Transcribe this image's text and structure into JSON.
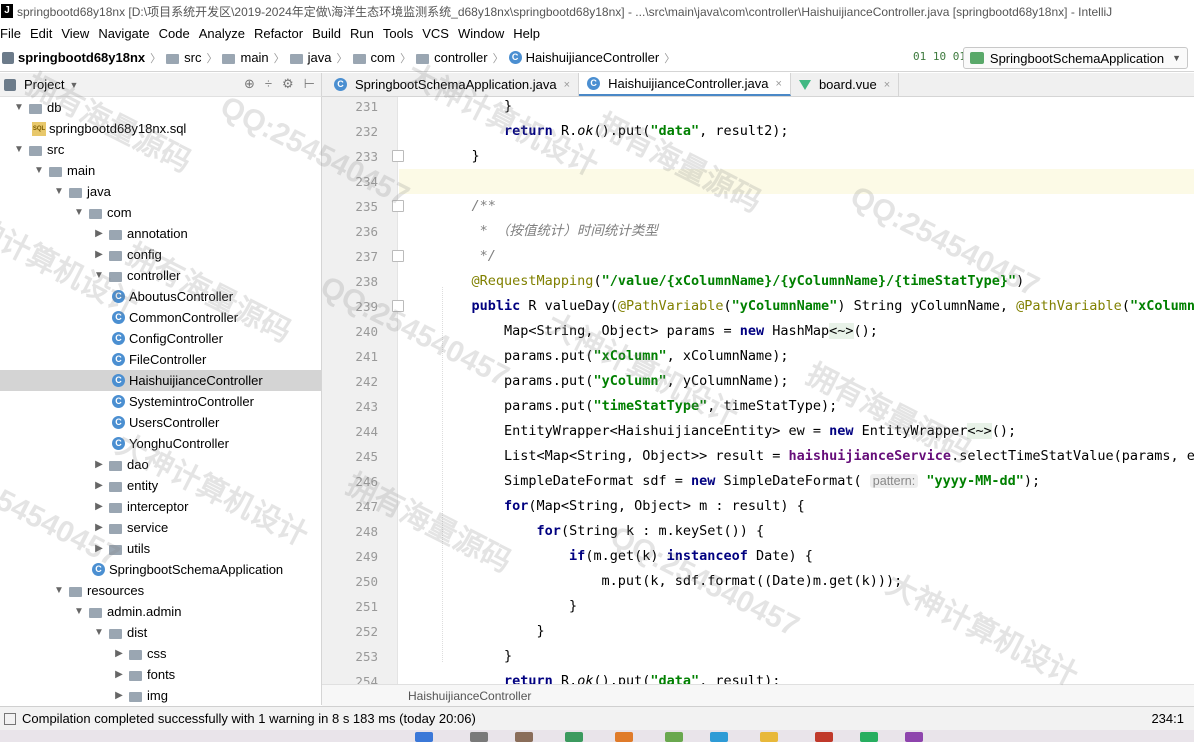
{
  "titlebar": {
    "text": "springbootd68y18nx [D:\\项目系统开发区\\2019-2024年定做\\海洋生态环境监测系统_d68y18nx\\springbootd68y18nx] - ...\\src\\main\\java\\com\\controller\\HaishuijianceController.java [springbootd68y18nx] - IntelliJ"
  },
  "menu": [
    "File",
    "Edit",
    "View",
    "Navigate",
    "Code",
    "Analyze",
    "Refactor",
    "Build",
    "Run",
    "Tools",
    "VCS",
    "Window",
    "Help"
  ],
  "breadcrumb": [
    "springbootd68y18nx",
    "src",
    "main",
    "java",
    "com",
    "controller",
    "HaishuijianceController"
  ],
  "run_config": "SpringbootSchemaApplication",
  "sort_label": "01 10 01",
  "project_panel": {
    "title": "Project",
    "dropdown_glyph": "▼",
    "tools": [
      "⊕",
      "÷",
      "⚙",
      "⊢"
    ]
  },
  "tree": [
    {
      "label": "db",
      "indent": 1,
      "arrow": "open",
      "icon": "folder"
    },
    {
      "label": "springbootd68y18nx.sql",
      "indent": 2,
      "arrow": "none",
      "icon": "sql"
    },
    {
      "label": "src",
      "indent": 1,
      "arrow": "open",
      "icon": "folder"
    },
    {
      "label": "main",
      "indent": 2,
      "arrow": "open",
      "icon": "folder"
    },
    {
      "label": "java",
      "indent": 3,
      "arrow": "open",
      "icon": "folder"
    },
    {
      "label": "com",
      "indent": 4,
      "arrow": "open",
      "icon": "folder"
    },
    {
      "label": "annotation",
      "indent": 5,
      "arrow": "closed",
      "icon": "folder"
    },
    {
      "label": "config",
      "indent": 5,
      "arrow": "closed",
      "icon": "folder"
    },
    {
      "label": "controller",
      "indent": 5,
      "arrow": "open",
      "icon": "folder"
    },
    {
      "label": "AboutusController",
      "indent": 6,
      "arrow": "none",
      "icon": "class"
    },
    {
      "label": "CommonController",
      "indent": 6,
      "arrow": "none",
      "icon": "class"
    },
    {
      "label": "ConfigController",
      "indent": 6,
      "arrow": "none",
      "icon": "class"
    },
    {
      "label": "FileController",
      "indent": 6,
      "arrow": "none",
      "icon": "class"
    },
    {
      "label": "HaishuijianceController",
      "indent": 6,
      "arrow": "none",
      "icon": "class",
      "selected": true
    },
    {
      "label": "SystemintroController",
      "indent": 6,
      "arrow": "none",
      "icon": "class"
    },
    {
      "label": "UsersController",
      "indent": 6,
      "arrow": "none",
      "icon": "class"
    },
    {
      "label": "YonghuController",
      "indent": 6,
      "arrow": "none",
      "icon": "class"
    },
    {
      "label": "dao",
      "indent": 5,
      "arrow": "closed",
      "icon": "folder"
    },
    {
      "label": "entity",
      "indent": 5,
      "arrow": "closed",
      "icon": "folder"
    },
    {
      "label": "interceptor",
      "indent": 5,
      "arrow": "closed",
      "icon": "folder"
    },
    {
      "label": "service",
      "indent": 5,
      "arrow": "closed",
      "icon": "folder"
    },
    {
      "label": "utils",
      "indent": 5,
      "arrow": "closed",
      "icon": "folder"
    },
    {
      "label": "SpringbootSchemaApplication",
      "indent": 5,
      "arrow": "none",
      "icon": "class"
    },
    {
      "label": "resources",
      "indent": 3,
      "arrow": "open",
      "icon": "folder"
    },
    {
      "label": "admin.admin",
      "indent": 4,
      "arrow": "open",
      "icon": "folder"
    },
    {
      "label": "dist",
      "indent": 5,
      "arrow": "open",
      "icon": "folder"
    },
    {
      "label": "css",
      "indent": 6,
      "arrow": "closed",
      "icon": "folder"
    },
    {
      "label": "fonts",
      "indent": 6,
      "arrow": "closed",
      "icon": "folder"
    },
    {
      "label": "img",
      "indent": 6,
      "arrow": "closed",
      "icon": "folder"
    }
  ],
  "tabs": [
    {
      "label": "SpringbootSchemaApplication.java",
      "icon": "class",
      "active": false
    },
    {
      "label": "HaishuijianceController.java",
      "icon": "class",
      "active": true
    },
    {
      "label": "board.vue",
      "icon": "vue",
      "active": false
    }
  ],
  "close_glyph": "×",
  "editor": {
    "line_numbers": [
      231,
      232,
      233,
      234,
      235,
      236,
      237,
      238,
      239,
      240,
      241,
      242,
      243,
      244,
      245,
      246,
      247,
      248,
      249,
      250,
      251,
      252,
      253,
      254
    ],
    "current_line": 234,
    "fold_markers": [
      233,
      235,
      237,
      239
    ],
    "lines": [
      [
        {
          "t": "        }",
          "c": ""
        }
      ],
      [
        {
          "t": "        ",
          "c": ""
        },
        {
          "t": "return",
          "c": "kw"
        },
        {
          "t": " R.",
          "c": ""
        },
        {
          "t": "ok",
          "c": "it"
        },
        {
          "t": "().put(",
          "c": ""
        },
        {
          "t": "\"data\"",
          "c": "str"
        },
        {
          "t": ", result2);",
          "c": ""
        }
      ],
      [
        {
          "t": "    }",
          "c": ""
        }
      ],
      [
        {
          "t": "",
          "c": ""
        }
      ],
      [
        {
          "t": "    /**",
          "c": "com"
        }
      ],
      [
        {
          "t": "     * （按值统计）时间统计类型",
          "c": "com"
        }
      ],
      [
        {
          "t": "     */",
          "c": "com"
        }
      ],
      [
        {
          "t": "    ",
          "c": ""
        },
        {
          "t": "@RequestMapping",
          "c": "ann"
        },
        {
          "t": "(",
          "c": ""
        },
        {
          "t": "\"/value/{xColumnName}/{yColumnName}/{timeStatType}\"",
          "c": "str"
        },
        {
          "t": ")",
          "c": ""
        }
      ],
      [
        {
          "t": "    ",
          "c": ""
        },
        {
          "t": "public",
          "c": "kw"
        },
        {
          "t": " R valueDay(",
          "c": ""
        },
        {
          "t": "@PathVariable",
          "c": "ann"
        },
        {
          "t": "(",
          "c": ""
        },
        {
          "t": "\"yColumnName\"",
          "c": "str"
        },
        {
          "t": ") String yColumnName, ",
          "c": ""
        },
        {
          "t": "@PathVariable",
          "c": "ann"
        },
        {
          "t": "(",
          "c": ""
        },
        {
          "t": "\"xColumnName\"",
          "c": "str"
        }
      ],
      [
        {
          "t": "        Map<String, Object> params = ",
          "c": ""
        },
        {
          "t": "new",
          "c": "kw"
        },
        {
          "t": " HashMap",
          "c": ""
        },
        {
          "t": "<~>",
          "c": "dia"
        },
        {
          "t": "();",
          "c": ""
        }
      ],
      [
        {
          "t": "        params.put(",
          "c": ""
        },
        {
          "t": "\"xColumn\"",
          "c": "str"
        },
        {
          "t": ", xColumnName);",
          "c": ""
        }
      ],
      [
        {
          "t": "        params.put(",
          "c": ""
        },
        {
          "t": "\"yColumn\"",
          "c": "str"
        },
        {
          "t": ", yColumnName);",
          "c": ""
        }
      ],
      [
        {
          "t": "        params.put(",
          "c": ""
        },
        {
          "t": "\"timeStatType\"",
          "c": "str"
        },
        {
          "t": ", timeStatType);",
          "c": ""
        }
      ],
      [
        {
          "t": "        EntityWrapper<HaishuijianceEntity> ew = ",
          "c": ""
        },
        {
          "t": "new",
          "c": "kw"
        },
        {
          "t": " EntityWrapper",
          "c": ""
        },
        {
          "t": "<~>",
          "c": "dia"
        },
        {
          "t": "();",
          "c": ""
        }
      ],
      [
        {
          "t": "        List<Map<String, Object>> result = ",
          "c": ""
        },
        {
          "t": "haishuijianceService",
          "c": "fld"
        },
        {
          "t": ".selectTimeStatValue(params, ew);",
          "c": ""
        }
      ],
      [
        {
          "t": "        SimpleDateFormat sdf = ",
          "c": ""
        },
        {
          "t": "new",
          "c": "kw"
        },
        {
          "t": " SimpleDateFormat( ",
          "c": ""
        },
        {
          "t": "pattern:",
          "c": "hint"
        },
        {
          "t": " ",
          "c": ""
        },
        {
          "t": "\"yyyy-MM-dd\"",
          "c": "str"
        },
        {
          "t": ");",
          "c": ""
        }
      ],
      [
        {
          "t": "        ",
          "c": ""
        },
        {
          "t": "for",
          "c": "kw"
        },
        {
          "t": "(Map<String, Object> m : result) {",
          "c": ""
        }
      ],
      [
        {
          "t": "            ",
          "c": ""
        },
        {
          "t": "for",
          "c": "kw"
        },
        {
          "t": "(String k : m.keySet()) {",
          "c": ""
        }
      ],
      [
        {
          "t": "                ",
          "c": ""
        },
        {
          "t": "if",
          "c": "kw"
        },
        {
          "t": "(m.get(k) ",
          "c": ""
        },
        {
          "t": "instanceof",
          "c": "kw"
        },
        {
          "t": " Date) {",
          "c": ""
        }
      ],
      [
        {
          "t": "                    m.put(k, sdf.format((Date)m.get(k)));",
          "c": ""
        }
      ],
      [
        {
          "t": "                }",
          "c": ""
        }
      ],
      [
        {
          "t": "            }",
          "c": ""
        }
      ],
      [
        {
          "t": "        }",
          "c": ""
        }
      ],
      [
        {
          "t": "        ",
          "c": ""
        },
        {
          "t": "return",
          "c": "kw"
        },
        {
          "t": " R.",
          "c": ""
        },
        {
          "t": "ok",
          "c": "it"
        },
        {
          "t": "().put(",
          "c": ""
        },
        {
          "t": "\"data\"",
          "c": "str"
        },
        {
          "t": ", result);",
          "c": ""
        }
      ]
    ]
  },
  "editor_breadcrumb": "HaishuijianceController",
  "status": {
    "message": "Compilation completed successfully with 1 warning in 8 s 183 ms (today 20:06)",
    "position": "234:1"
  },
  "watermarks": [
    "拥有海量源码",
    "QQ:254540457",
    "大神计算机设计",
    "拥有海量源码",
    "QQ:254540457",
    "大神计算机设计",
    "拥有海量源码",
    "QQ:254540457",
    "大神计算机设计",
    "拥有海量源码",
    "QQ:254540457",
    "大神计算机设计",
    "拥有海量源码",
    "QQ:254540457",
    "大神计算机设计"
  ],
  "colors": {
    "accent": "#4a88c7",
    "selection": "#d4d4d4",
    "keyword": "#000080",
    "string": "#008000",
    "annotation": "#808000",
    "comment": "#808080",
    "field": "#660e7a"
  }
}
